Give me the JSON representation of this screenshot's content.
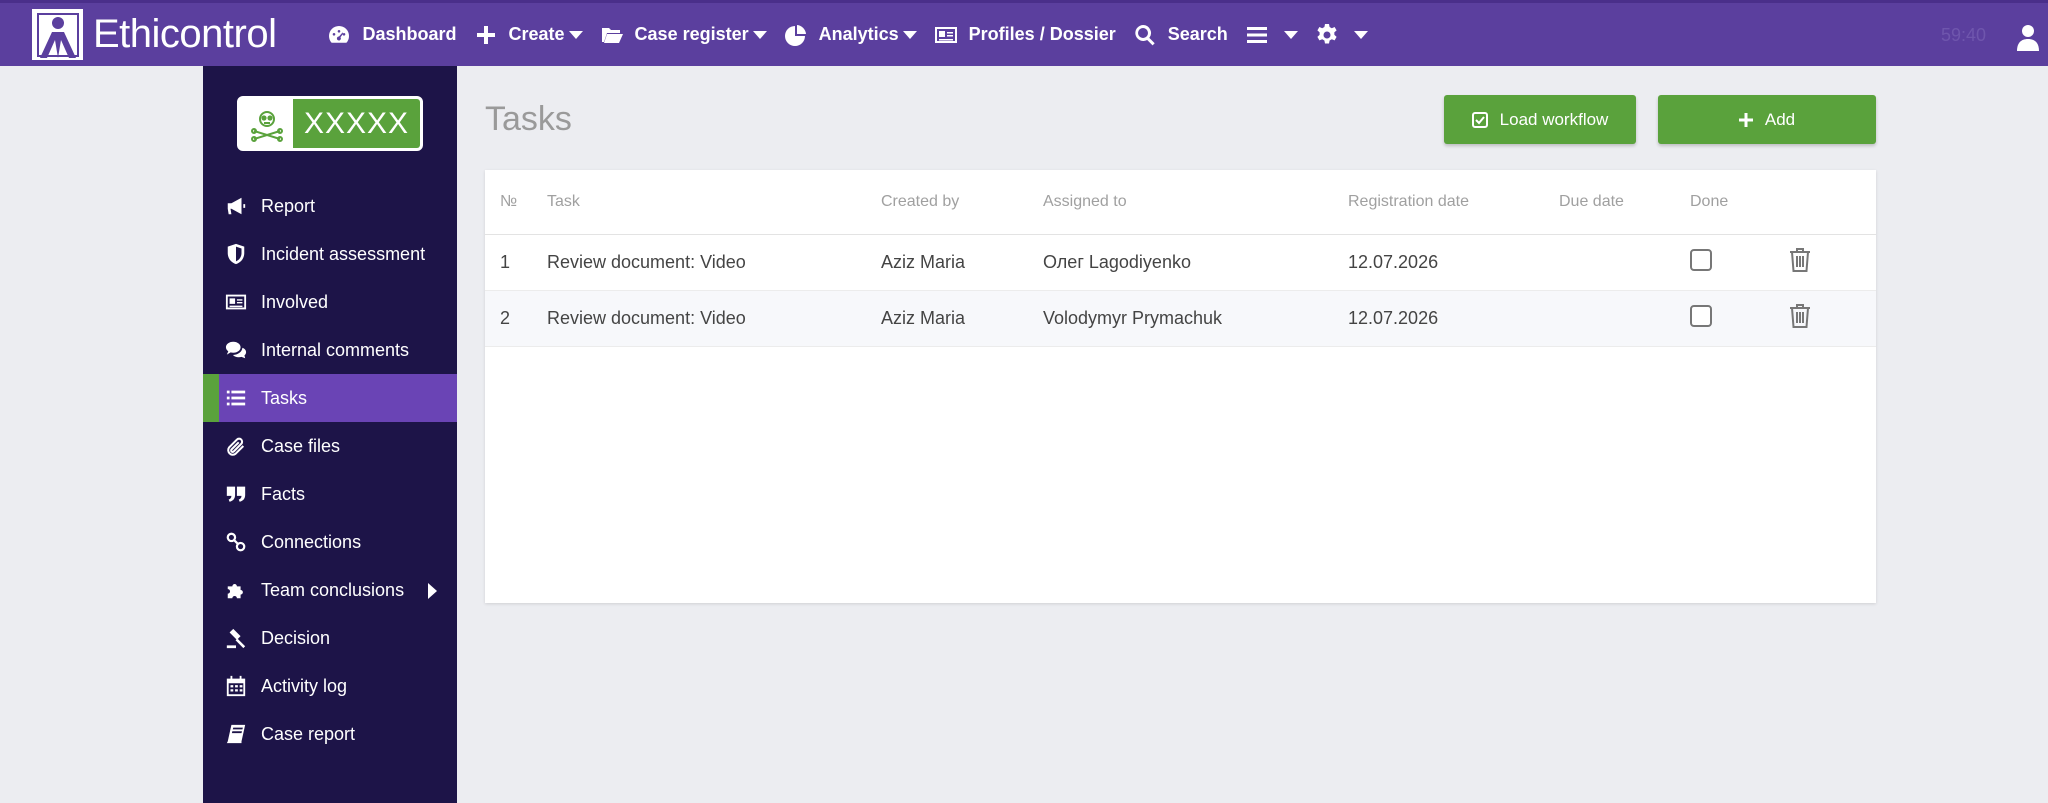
{
  "app": {
    "name": "Ethicontrol",
    "timer": "59:40"
  },
  "nav": {
    "items": [
      {
        "label": "Dashboard",
        "icon": "dashboard-icon",
        "caret": false
      },
      {
        "label": "Create",
        "icon": "plus-icon",
        "caret": true
      },
      {
        "label": "Case register",
        "icon": "folder-open-icon",
        "caret": true
      },
      {
        "label": "Analytics",
        "icon": "pie-chart-icon",
        "caret": true
      },
      {
        "label": "Profiles / Dossier",
        "icon": "id-card-icon",
        "caret": false
      },
      {
        "label": "Search",
        "icon": "search-icon",
        "caret": false
      }
    ]
  },
  "case_badge": {
    "code": "XXXXX",
    "icon": "biohazard-icon"
  },
  "sidebar": {
    "items": [
      {
        "label": "Report",
        "icon": "megaphone-icon"
      },
      {
        "label": "Incident assessment",
        "icon": "shield-icon"
      },
      {
        "label": "Involved",
        "icon": "id-card-icon"
      },
      {
        "label": "Internal comments",
        "icon": "comments-icon"
      },
      {
        "label": "Tasks",
        "icon": "list-icon",
        "active": true
      },
      {
        "label": "Case files",
        "icon": "paperclip-icon"
      },
      {
        "label": "Facts",
        "icon": "quote-icon"
      },
      {
        "label": "Connections",
        "icon": "link-icon"
      },
      {
        "label": "Team conclusions",
        "icon": "puzzle-icon",
        "expandable": true
      },
      {
        "label": "Decision",
        "icon": "gavel-icon"
      },
      {
        "label": "Activity log",
        "icon": "calendar-icon"
      },
      {
        "label": "Case report",
        "icon": "book-icon"
      }
    ]
  },
  "main": {
    "title": "Tasks",
    "load_workflow_label": "Load workflow",
    "add_label": "Add",
    "table": {
      "headers": [
        "№",
        "Task",
        "Created by",
        "Assigned to",
        "Registration date",
        "Due date",
        "Done"
      ],
      "rows": [
        {
          "no": "1",
          "task": "Review document: Video",
          "created_by": "Aziz Maria",
          "assigned_to": "Олег Lagodiyenko",
          "registration_date": "12.07.2026",
          "due_date": "",
          "done": false
        },
        {
          "no": "2",
          "task": "Review document: Video",
          "created_by": "Aziz Maria",
          "assigned_to": "Volodymyr Prymachuk",
          "registration_date": "12.07.2026",
          "due_date": "",
          "done": false
        }
      ]
    }
  },
  "colors": {
    "nav_bg": "#5b3f9e",
    "sidebar_bg": "#1d1448",
    "accent_green": "#5aa23c",
    "active_item": "#6a44b5"
  }
}
